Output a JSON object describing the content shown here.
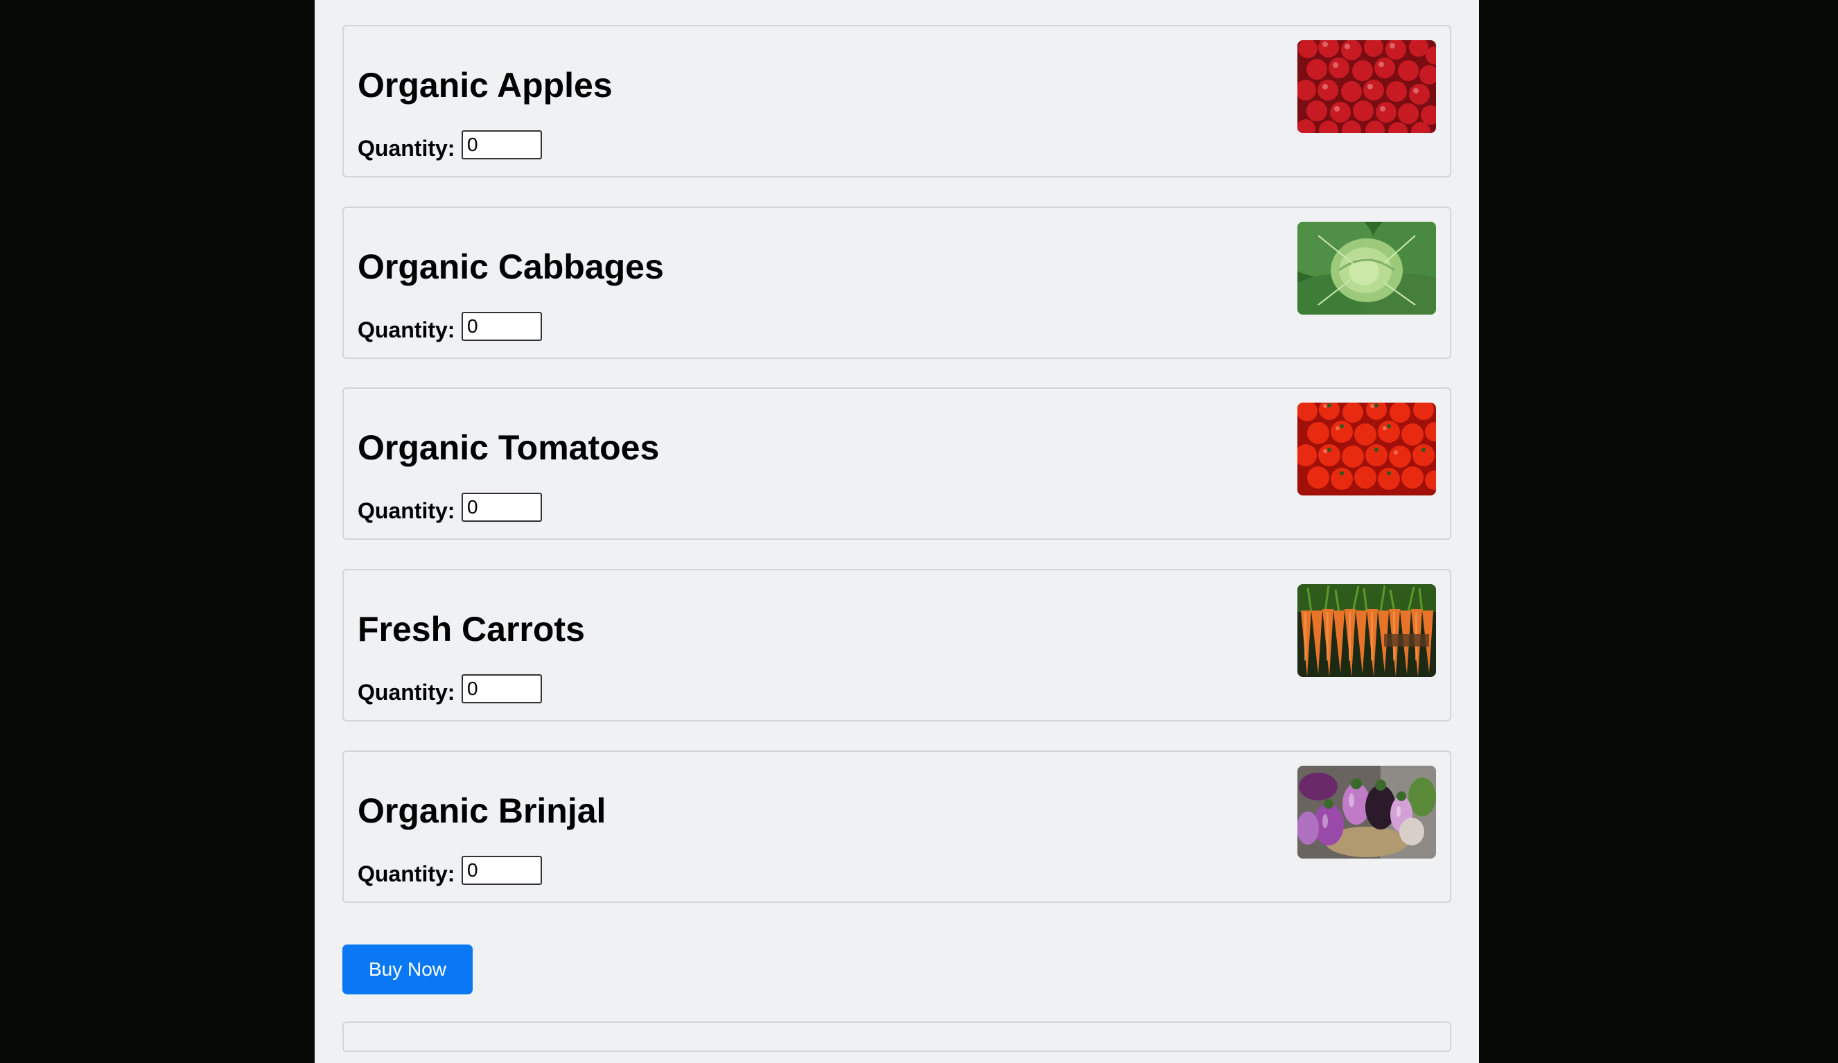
{
  "products": [
    {
      "name": "Organic Apples",
      "quantity_label": "Quantity:",
      "quantity": "0",
      "image": "apples-photo"
    },
    {
      "name": "Organic Cabbages",
      "quantity_label": "Quantity:",
      "quantity": "0",
      "image": "cabbage-photo"
    },
    {
      "name": "Organic Tomatoes",
      "quantity_label": "Quantity:",
      "quantity": "0",
      "image": "tomatoes-photo"
    },
    {
      "name": "Fresh Carrots",
      "quantity_label": "Quantity:",
      "quantity": "0",
      "image": "carrots-photo"
    },
    {
      "name": "Organic Brinjal",
      "quantity_label": "Quantity:",
      "quantity": "0",
      "image": "brinjal-photo"
    }
  ],
  "buy_button": {
    "label": "Buy Now",
    "color": "#0a78f5"
  }
}
